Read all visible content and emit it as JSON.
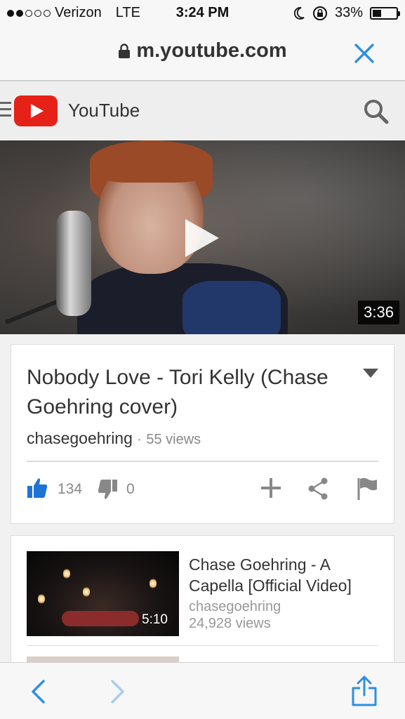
{
  "status_bar": {
    "carrier": "Verizon",
    "network": "LTE",
    "time": "3:24 PM",
    "battery": "33%",
    "battery_level": 0.33,
    "signal_bars_filled": 2,
    "signal_bars_total": 5
  },
  "browser": {
    "url": "m.youtube.com"
  },
  "header": {
    "app_name": "YouTube"
  },
  "video": {
    "duration": "3:36",
    "title": "Nobody Love - Tori Kelly (Chase Goehring cover)",
    "channel": "chasegoehring",
    "separator": "·",
    "views": "55 views",
    "likes": "134",
    "dislikes": "0"
  },
  "related": [
    {
      "title": "Chase Goehring - A Capella [Official Video]",
      "channel": "chasegoehring",
      "views": "24,928 views",
      "duration": "5:10"
    }
  ],
  "colors": {
    "youtube_red": "#e62117",
    "ios_blue": "#2f8fe0",
    "like_blue": "#1e73d6"
  }
}
